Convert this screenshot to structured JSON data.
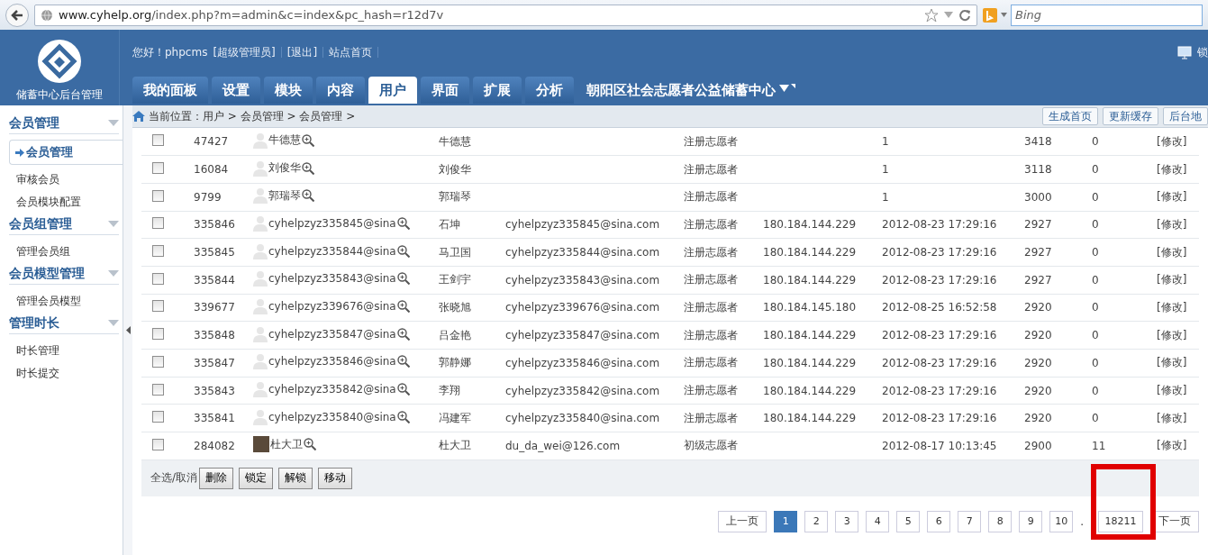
{
  "browser": {
    "url_host": "www.cyhelp.org",
    "url_path": "/index.php?m=admin&c=index&pc_hash=r12d7v",
    "search_placeholder": "Bing"
  },
  "header": {
    "logo_text": "储蓄中心后台管理",
    "greeting": "您好！phpcms",
    "role": "[超级管理员]",
    "logout": "[退出]",
    "home": "站点首页",
    "lock": "锁",
    "tabs": [
      {
        "label": "我的面板",
        "selected": false
      },
      {
        "label": "设置",
        "selected": false
      },
      {
        "label": "模块",
        "selected": false
      },
      {
        "label": "内容",
        "selected": false
      },
      {
        "label": "用户",
        "selected": true
      },
      {
        "label": "界面",
        "selected": false
      },
      {
        "label": "扩展",
        "selected": false
      },
      {
        "label": "分析",
        "selected": false
      }
    ],
    "site_name": "朝阳区社会志愿者公益储蓄中心"
  },
  "breadcrumb": "当前位置：用户 > 会员管理 > 会员管理 >",
  "toolbar_buttons": [
    "生成首页",
    "更新缓存",
    "后台地"
  ],
  "sidebar": [
    {
      "title": "会员管理",
      "items": [
        {
          "label": "会员管理",
          "selected": true
        },
        {
          "label": "审核会员",
          "selected": false
        },
        {
          "label": "会员模块配置",
          "selected": false
        }
      ]
    },
    {
      "title": "会员组管理",
      "items": [
        {
          "label": "管理会员组",
          "selected": false
        }
      ]
    },
    {
      "title": "会员模型管理",
      "items": [
        {
          "label": "管理会员模型",
          "selected": false
        }
      ]
    },
    {
      "title": "管理时长",
      "items": [
        {
          "label": "时长管理",
          "selected": false
        },
        {
          "label": "时长提交",
          "selected": false
        }
      ]
    }
  ],
  "rows": [
    {
      "id": "47427",
      "username": "牛德慧",
      "avatar_photo": false,
      "nickname": "牛德慧",
      "email": "",
      "group": "注册志愿者",
      "ip": "",
      "time": "1",
      "points": "3418",
      "count": "0",
      "action": "[修改]",
      "checked": false
    },
    {
      "id": "16084",
      "username": "刘俊华",
      "avatar_photo": false,
      "nickname": "刘俊华",
      "email": "",
      "group": "注册志愿者",
      "ip": "",
      "time": "1",
      "points": "3118",
      "count": "0",
      "action": "[修改]",
      "checked": false
    },
    {
      "id": "9799",
      "username": "郭瑞琴",
      "avatar_photo": false,
      "nickname": "郭瑞琴",
      "email": "",
      "group": "注册志愿者",
      "ip": "",
      "time": "1",
      "points": "3000",
      "count": "0",
      "action": "[修改]",
      "checked": false
    },
    {
      "id": "335846",
      "username": "cyhelpzyz335845@sina",
      "avatar_photo": false,
      "nickname": "石坤",
      "email": "cyhelpzyz335845@sina.com",
      "group": "注册志愿者",
      "ip": "180.184.144.229",
      "time": "2012-08-23 17:29:16",
      "points": "2927",
      "count": "0",
      "action": "[修改]",
      "checked": false
    },
    {
      "id": "335845",
      "username": "cyhelpzyz335844@sina",
      "avatar_photo": false,
      "nickname": "马卫国",
      "email": "cyhelpzyz335844@sina.com",
      "group": "注册志愿者",
      "ip": "180.184.144.229",
      "time": "2012-08-23 17:29:16",
      "points": "2927",
      "count": "0",
      "action": "[修改]",
      "checked": false
    },
    {
      "id": "335844",
      "username": "cyhelpzyz335843@sina",
      "avatar_photo": false,
      "nickname": "王剑宇",
      "email": "cyhelpzyz335843@sina.com",
      "group": "注册志愿者",
      "ip": "180.184.144.229",
      "time": "2012-08-23 17:29:16",
      "points": "2927",
      "count": "0",
      "action": "[修改]",
      "checked": false
    },
    {
      "id": "339677",
      "username": "cyhelpzyz339676@sina",
      "avatar_photo": false,
      "nickname": "张晓旭",
      "email": "cyhelpzyz339676@sina.com",
      "group": "注册志愿者",
      "ip": "180.184.145.180",
      "time": "2012-08-25 16:52:58",
      "points": "2920",
      "count": "0",
      "action": "[修改]",
      "checked": false
    },
    {
      "id": "335848",
      "username": "cyhelpzyz335847@sina",
      "avatar_photo": false,
      "nickname": "吕金艳",
      "email": "cyhelpzyz335847@sina.com",
      "group": "注册志愿者",
      "ip": "180.184.144.229",
      "time": "2012-08-23 17:29:16",
      "points": "2920",
      "count": "0",
      "action": "[修改]",
      "checked": false
    },
    {
      "id": "335847",
      "username": "cyhelpzyz335846@sina",
      "avatar_photo": false,
      "nickname": "郭静娜",
      "email": "cyhelpzyz335846@sina.com",
      "group": "注册志愿者",
      "ip": "180.184.144.229",
      "time": "2012-08-23 17:29:16",
      "points": "2920",
      "count": "0",
      "action": "[修改]",
      "checked": false
    },
    {
      "id": "335843",
      "username": "cyhelpzyz335842@sina",
      "avatar_photo": false,
      "nickname": "李翔",
      "email": "cyhelpzyz335842@sina.com",
      "group": "注册志愿者",
      "ip": "180.184.144.229",
      "time": "2012-08-23 17:29:16",
      "points": "2920",
      "count": "0",
      "action": "[修改]",
      "checked": false
    },
    {
      "id": "335841",
      "username": "cyhelpzyz335840@sina",
      "avatar_photo": false,
      "nickname": "冯建军",
      "email": "cyhelpzyz335840@sina.com",
      "group": "注册志愿者",
      "ip": "180.184.144.229",
      "time": "2012-08-23 17:29:16",
      "points": "2920",
      "count": "0",
      "action": "[修改]",
      "checked": false
    },
    {
      "id": "284082",
      "username": "杜大卫",
      "avatar_photo": true,
      "nickname": "杜大卫",
      "email": "du_da_wei@126.com",
      "group": "初级志愿者",
      "ip": "",
      "time": "2012-08-17 10:13:45",
      "points": "2900",
      "count": "11",
      "action": "[修改]",
      "checked": false
    }
  ],
  "select_all": "全选/取消",
  "actions": [
    "删除",
    "锁定",
    "解锁",
    "移动"
  ],
  "pagination": {
    "prev": "上一页",
    "pages": [
      {
        "label": "1",
        "selected": true
      },
      {
        "label": "2",
        "selected": false
      },
      {
        "label": "3",
        "selected": false
      },
      {
        "label": "4",
        "selected": false
      },
      {
        "label": "5",
        "selected": false
      },
      {
        "label": "6",
        "selected": false
      },
      {
        "label": "7",
        "selected": false
      },
      {
        "label": "8",
        "selected": false
      },
      {
        "label": "9",
        "selected": false
      },
      {
        "label": "10",
        "selected": false
      }
    ],
    "ellipsis": ".",
    "last": "18211",
    "next": "下一页"
  }
}
